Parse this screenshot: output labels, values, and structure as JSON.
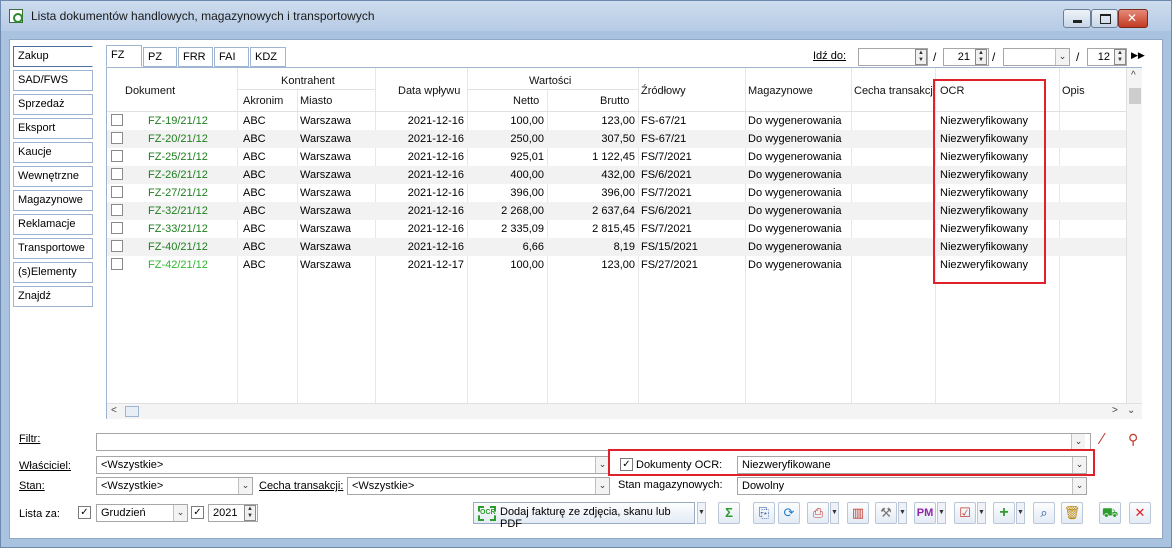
{
  "window": {
    "title": "Lista dokumentów handlowych, magazynowych i transportowych"
  },
  "sidebar": {
    "items": [
      {
        "label": "Zakup"
      },
      {
        "label": "SAD/FWS"
      },
      {
        "label": "Sprzedaż"
      },
      {
        "label": "Eksport"
      },
      {
        "label": "Kaucje"
      },
      {
        "label": "Wewnętrzne"
      },
      {
        "label": "Magazynowe"
      },
      {
        "label": "Reklamacje"
      },
      {
        "label": "Transportowe"
      },
      {
        "label": "(s)Elementy"
      },
      {
        "label": "Znajdź"
      }
    ]
  },
  "tabs": [
    {
      "label": "FZ"
    },
    {
      "label": "PZ"
    },
    {
      "label": "FRR"
    },
    {
      "label": "FAI"
    },
    {
      "label": "KDZ"
    }
  ],
  "goto": {
    "label": "Idź do:",
    "field1": "",
    "field2": "21",
    "field3": "",
    "field4": "12"
  },
  "grid": {
    "headers": {
      "dokument": "Dokument",
      "kontrahent": "Kontrahent",
      "akronim": "Akronim",
      "miasto": "Miasto",
      "data_wplywu": "Data wpływu",
      "wartosci": "Wartości",
      "netto": "Netto",
      "brutto": "Brutto",
      "zrodlowy": "Źródłowy",
      "magazynowe": "Magazynowe",
      "cecha": "Cecha transakcji",
      "ocr": "OCR",
      "opis": "Opis"
    },
    "rows": [
      {
        "dokument": "FZ-19/21/12",
        "akronim": "ABC",
        "miasto": "Warszawa",
        "data": "2021-12-16",
        "netto": "100,00",
        "brutto": "123,00",
        "zrodlowy": "FS-67/21",
        "magazynowe": "Do wygenerowania",
        "cecha": "",
        "ocr": "Niezweryfikowany",
        "opis": ""
      },
      {
        "dokument": "FZ-20/21/12",
        "akronim": "ABC",
        "miasto": "Warszawa",
        "data": "2021-12-16",
        "netto": "250,00",
        "brutto": "307,50",
        "zrodlowy": "FS-67/21",
        "magazynowe": "Do wygenerowania",
        "cecha": "",
        "ocr": "Niezweryfikowany",
        "opis": ""
      },
      {
        "dokument": "FZ-25/21/12",
        "akronim": "ABC",
        "miasto": "Warszawa",
        "data": "2021-12-16",
        "netto": "925,01",
        "brutto": "1 122,45",
        "zrodlowy": "FS/7/2021",
        "magazynowe": "Do wygenerowania",
        "cecha": "",
        "ocr": "Niezweryfikowany",
        "opis": ""
      },
      {
        "dokument": "FZ-26/21/12",
        "akronim": "ABC",
        "miasto": "Warszawa",
        "data": "2021-12-16",
        "netto": "400,00",
        "brutto": "432,00",
        "zrodlowy": "FS/6/2021",
        "magazynowe": "Do wygenerowania",
        "cecha": "",
        "ocr": "Niezweryfikowany",
        "opis": ""
      },
      {
        "dokument": "FZ-27/21/12",
        "akronim": "ABC",
        "miasto": "Warszawa",
        "data": "2021-12-16",
        "netto": "396,00",
        "brutto": "396,00",
        "zrodlowy": "FS/7/2021",
        "magazynowe": "Do wygenerowania",
        "cecha": "",
        "ocr": "Niezweryfikowany",
        "opis": ""
      },
      {
        "dokument": "FZ-32/21/12",
        "akronim": "ABC",
        "miasto": "Warszawa",
        "data": "2021-12-16",
        "netto": "2 268,00",
        "brutto": "2 637,64",
        "zrodlowy": "FS/6/2021",
        "magazynowe": "Do wygenerowania",
        "cecha": "",
        "ocr": "Niezweryfikowany",
        "opis": ""
      },
      {
        "dokument": "FZ-33/21/12",
        "akronim": "ABC",
        "miasto": "Warszawa",
        "data": "2021-12-16",
        "netto": "2 335,09",
        "brutto": "2 815,45",
        "zrodlowy": "FS/7/2021",
        "magazynowe": "Do wygenerowania",
        "cecha": "",
        "ocr": "Niezweryfikowany",
        "opis": ""
      },
      {
        "dokument": "FZ-40/21/12",
        "akronim": "ABC",
        "miasto": "Warszawa",
        "data": "2021-12-16",
        "netto": "6,66",
        "brutto": "8,19",
        "zrodlowy": "FS/15/2021",
        "magazynowe": "Do wygenerowania",
        "cecha": "",
        "ocr": "Niezweryfikowany",
        "opis": ""
      },
      {
        "dokument": "FZ-42/21/12",
        "akronim": "ABC",
        "miasto": "Warszawa",
        "data": "2021-12-17",
        "netto": "100,00",
        "brutto": "123,00",
        "zrodlowy": "FS/27/2021",
        "magazynowe": "Do wygenerowania",
        "cecha": "",
        "ocr": "Niezweryfikowany",
        "opis": ""
      }
    ]
  },
  "filters": {
    "filtr_label": "Filtr:",
    "filtr_value": "",
    "wlasciciel_label": "Właściciel:",
    "wlasciciel_value": "<Wszystkie>",
    "stan_label": "Stan:",
    "stan_value": "<Wszystkie>",
    "cecha_label": "Cecha transakcji:",
    "cecha_value": "<Wszystkie>",
    "ocr_docs_label": "Dokumenty OCR:",
    "ocr_docs_value": "Niezweryfikowane",
    "stan_mag_label": "Stan magazynowych:",
    "stan_mag_value": "Dowolny"
  },
  "bottom": {
    "lista_za_label": "Lista za:",
    "month": "Grudzień",
    "year": "2021",
    "ocr_button": "Dodaj fakturę ze zdjęcia, skanu lub PDF",
    "ocr_icon_text": "OCR",
    "pm_label": "PM",
    "sigma": "Σ"
  },
  "colors": {
    "accent_red": "#e0212b",
    "doc_link_green": "#1d7f1d"
  }
}
